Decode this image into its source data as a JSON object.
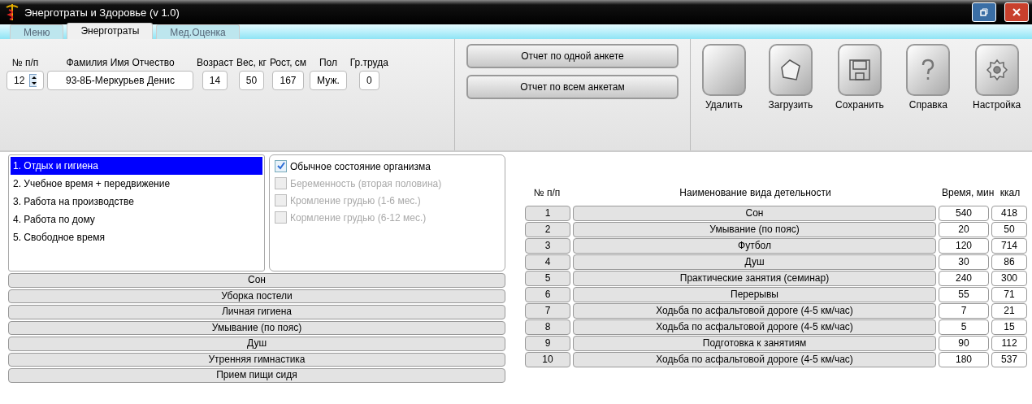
{
  "window": {
    "title": "Энерготраты и Здоровье (v 1.0)"
  },
  "tabs": [
    {
      "label": "Меню",
      "selected": false
    },
    {
      "label": "Энерготраты",
      "selected": true
    },
    {
      "label": "Мед.Оценка",
      "selected": false
    }
  ],
  "form": {
    "fields": [
      {
        "label": "№ п/п",
        "value": "12",
        "kind": "spinner"
      },
      {
        "label": "Фамилия Имя Отчество",
        "value": "93-8Б-Меркурьев Денис",
        "kind": "text"
      },
      {
        "label": "Возраст",
        "value": "14",
        "kind": "text"
      },
      {
        "label": "Вес, кг",
        "value": "50",
        "kind": "text"
      },
      {
        "label": "Рост, см",
        "value": "167",
        "kind": "text"
      },
      {
        "label": "Пол",
        "value": "Муж.",
        "kind": "text"
      },
      {
        "label": "Гр.труда",
        "value": "0",
        "kind": "text"
      }
    ]
  },
  "report_buttons": [
    "Отчет по одной анкете",
    "Отчет по всем анкетам"
  ],
  "toolbar": [
    {
      "label": "Удалить",
      "kind": "blank"
    },
    {
      "label": "Загрузить",
      "kind": "open"
    },
    {
      "label": "Сохранить",
      "kind": "save"
    },
    {
      "label": "Справка",
      "kind": "help"
    },
    {
      "label": "Настройка",
      "kind": "settings"
    }
  ],
  "categories": [
    {
      "label": "1. Отдых и гигиена",
      "selected": true
    },
    {
      "label": "2. Учебное время + передвижение",
      "selected": false
    },
    {
      "label": "3. Работа на производстве",
      "selected": false
    },
    {
      "label": "4. Работа по дому",
      "selected": false
    },
    {
      "label": "5. Свободное время",
      "selected": false
    }
  ],
  "conditions": [
    {
      "label": "Обычное состояние организма",
      "checked": true,
      "disabled": false
    },
    {
      "label": "Беременность (вторая половина)",
      "checked": false,
      "disabled": true
    },
    {
      "label": "Кромление грудью (1-6 мес.)",
      "checked": false,
      "disabled": true
    },
    {
      "label": "Кормление грудью (6-12 мес.)",
      "checked": false,
      "disabled": true
    }
  ],
  "activities": [
    "Сон",
    "Уборка постели",
    "Личная гигиена",
    "Умывание (по пояс)",
    "Душ",
    "Утренняя гимнастика",
    "Прием пищи сидя"
  ],
  "table": {
    "columns": [
      "№ п/п",
      "Наименование вида детельности",
      "Время, мин",
      "ккал"
    ],
    "rows": [
      [
        "1",
        "Сон",
        "540",
        "418"
      ],
      [
        "2",
        "Умывание (по пояс)",
        "20",
        "50"
      ],
      [
        "3",
        "Футбол",
        "120",
        "714"
      ],
      [
        "4",
        "Душ",
        "30",
        "86"
      ],
      [
        "5",
        "Практические занятия (семинар)",
        "240",
        "300"
      ],
      [
        "6",
        "Перерывы",
        "55",
        "71"
      ],
      [
        "7",
        "Ходьба по асфальтовой дороге (4-5 км/час)",
        "7",
        "21"
      ],
      [
        "8",
        "Ходьба по асфальтовой дороге (4-5 км/час)",
        "5",
        "15"
      ],
      [
        "9",
        "Подготовка к занятиям",
        "90",
        "112"
      ],
      [
        "10",
        "Ходьба по асфальтовой дороге (4-5 км/час)",
        "180",
        "537"
      ]
    ]
  }
}
